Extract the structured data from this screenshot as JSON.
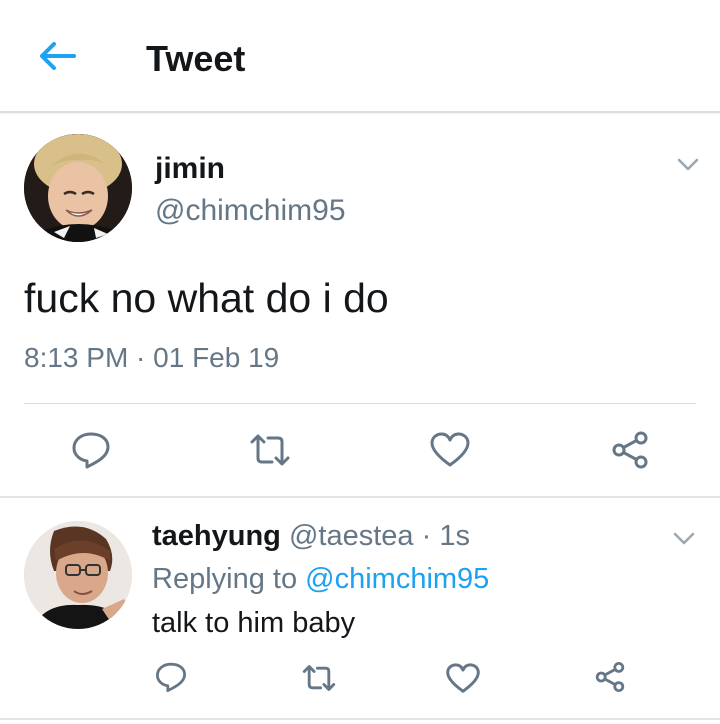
{
  "header": {
    "title": "Tweet",
    "back_icon": "arrow-left-icon"
  },
  "tweet": {
    "author_name": "jimin",
    "author_handle": "@chimchim95",
    "text": "fuck no what do i do",
    "timestamp": "8:13 PM · 01 Feb 19",
    "actions": [
      "reply-icon",
      "retweet-icon",
      "like-icon",
      "share-icon"
    ]
  },
  "reply": {
    "author_name": "taehyung",
    "author_handle": "@taestea",
    "time_ago": "· 1s",
    "replying_to_label": "Replying to",
    "replying_to_handle": "@chimchim95",
    "text": "talk to him baby",
    "actions": [
      "reply-icon",
      "retweet-icon",
      "like-icon",
      "share-icon"
    ]
  },
  "colors": {
    "accent": "#1da1f2",
    "secondary_text": "#657786",
    "icon": "#657786",
    "primary_text": "#14171a"
  }
}
